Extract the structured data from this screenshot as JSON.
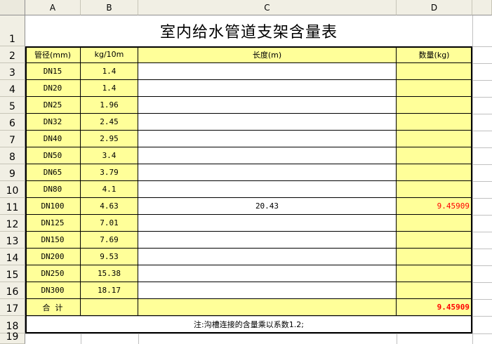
{
  "sheet": {
    "columns": [
      "A",
      "B",
      "C",
      "D"
    ],
    "rows": [
      "1",
      "2",
      "3",
      "4",
      "5",
      "6",
      "7",
      "8",
      "9",
      "10",
      "11",
      "12",
      "13",
      "14",
      "15",
      "16",
      "17",
      "18",
      "19"
    ],
    "title": "室内给水管道支架含量表",
    "headers": {
      "diameter": "管径(mm)",
      "unit_weight": "kg/10m",
      "length": "长度(m)",
      "quantity": "数量(kg)"
    },
    "data_rows": [
      {
        "diameter": "DN15",
        "unit_weight": "1.4",
        "length": "",
        "quantity": ""
      },
      {
        "diameter": "DN20",
        "unit_weight": "1.4",
        "length": "",
        "quantity": ""
      },
      {
        "diameter": "DN25",
        "unit_weight": "1.96",
        "length": "",
        "quantity": ""
      },
      {
        "diameter": "DN32",
        "unit_weight": "2.45",
        "length": "",
        "quantity": ""
      },
      {
        "diameter": "DN40",
        "unit_weight": "2.95",
        "length": "",
        "quantity": ""
      },
      {
        "diameter": "DN50",
        "unit_weight": "3.4",
        "length": "",
        "quantity": ""
      },
      {
        "diameter": "DN65",
        "unit_weight": "3.79",
        "length": "",
        "quantity": ""
      },
      {
        "diameter": "DN80",
        "unit_weight": "4.1",
        "length": "",
        "quantity": ""
      },
      {
        "diameter": "DN100",
        "unit_weight": "4.63",
        "length": "20.43",
        "quantity": "9.45909"
      },
      {
        "diameter": "DN125",
        "unit_weight": "7.01",
        "length": "",
        "quantity": ""
      },
      {
        "diameter": "DN150",
        "unit_weight": "7.69",
        "length": "",
        "quantity": ""
      },
      {
        "diameter": "DN200",
        "unit_weight": "9.53",
        "length": "",
        "quantity": ""
      },
      {
        "diameter": "DN250",
        "unit_weight": "15.38",
        "length": "",
        "quantity": ""
      },
      {
        "diameter": "DN300",
        "unit_weight": "18.17",
        "length": "",
        "quantity": ""
      }
    ],
    "total_label": "合  计",
    "total_value": "9.45909",
    "note": "注:沟槽连接的含量乘以系数1.2;"
  },
  "colors": {
    "cell_yellow": "#ffff99",
    "value_red": "#ff0000",
    "header_bg": "#f1efe4"
  }
}
